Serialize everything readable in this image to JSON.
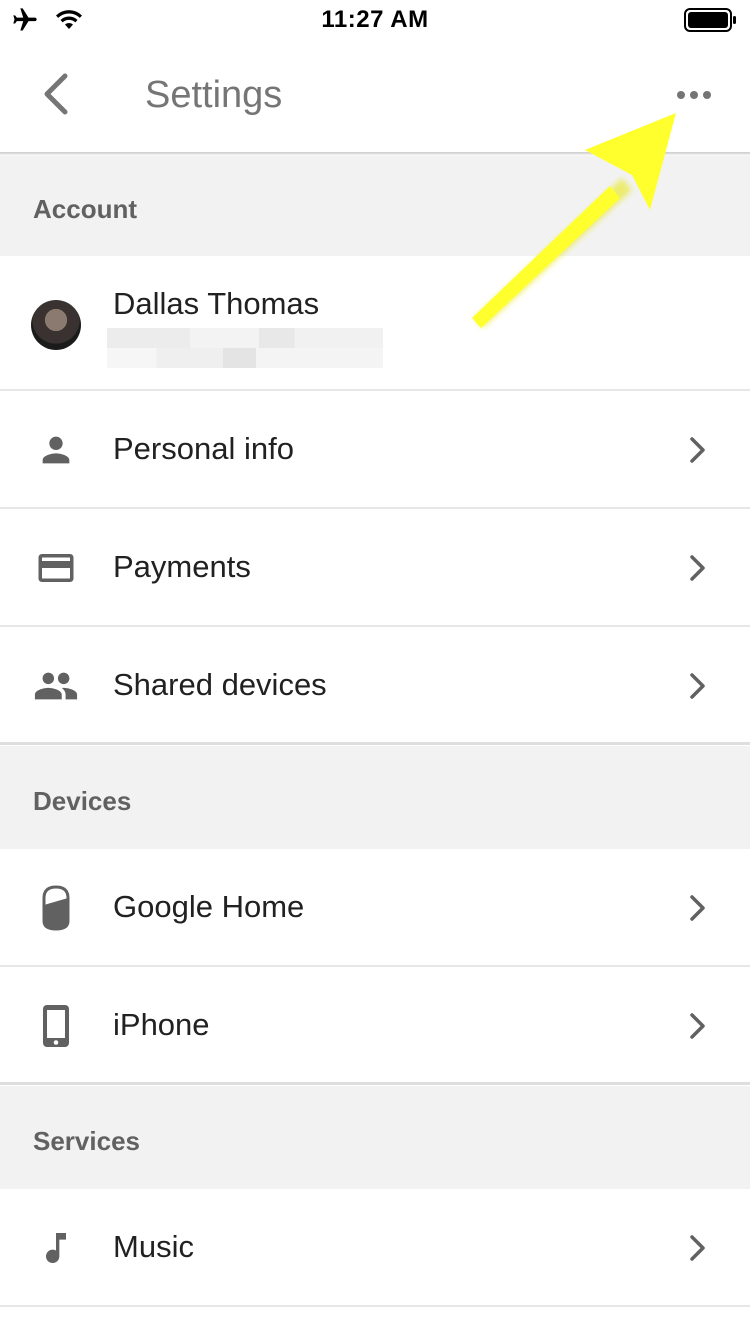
{
  "status_bar": {
    "time": "11:27 AM",
    "icons": [
      "airplane-icon",
      "wifi-icon",
      "battery-icon"
    ]
  },
  "header": {
    "title": "Settings",
    "back_icon": "chevron-left-icon",
    "more_icon": "more-horizontal-icon"
  },
  "sections": {
    "account": {
      "header": "Account",
      "profile": {
        "name": "Dallas Thomas"
      },
      "items": [
        {
          "label": "Personal info",
          "icon": "person-icon"
        },
        {
          "label": "Payments",
          "icon": "credit-card-icon"
        },
        {
          "label": "Shared devices",
          "icon": "people-icon"
        }
      ]
    },
    "devices": {
      "header": "Devices",
      "items": [
        {
          "label": "Google Home",
          "icon": "google-home-icon"
        },
        {
          "label": "iPhone",
          "icon": "phone-icon"
        }
      ]
    },
    "services": {
      "header": "Services",
      "items": [
        {
          "label": "Music",
          "icon": "music-note-icon"
        }
      ]
    }
  },
  "colors": {
    "title_gray": "#757575",
    "section_bg": "#f2f2f2",
    "icon_gray": "#616161",
    "divider": "#e6e6e6",
    "annotation_arrow": "#ffff2e"
  }
}
